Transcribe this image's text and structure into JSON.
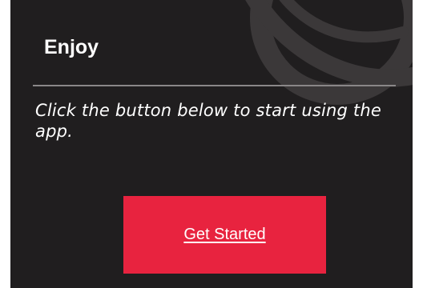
{
  "onboarding": {
    "title": "Enjoy",
    "message": "Click the button below to start using the app.",
    "button_label": "Get Started"
  },
  "colors": {
    "background": "#201e1f",
    "accent": "#e8233f",
    "divider": "#8a8788",
    "text": "#ffffff"
  },
  "icons": {
    "background_logo": "eye-swirl-logo"
  }
}
